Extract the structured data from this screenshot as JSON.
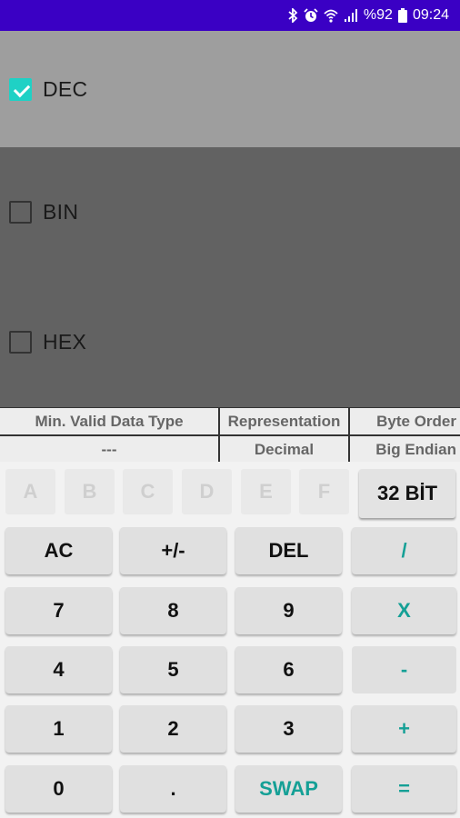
{
  "status_bar": {
    "battery_text": "%92",
    "time": "09:24",
    "icons": [
      "bluetooth-icon",
      "alarm-icon",
      "wifi-icon",
      "signal-icon",
      "battery-icon"
    ]
  },
  "modes": [
    {
      "label": "DEC",
      "checked": true
    },
    {
      "label": "BIN",
      "checked": false
    },
    {
      "label": "HEX",
      "checked": false
    }
  ],
  "info_table": {
    "headers": [
      "Min. Valid Data Type",
      "Representation",
      "Byte Order"
    ],
    "values": [
      "---",
      "Decimal",
      "Big Endian"
    ]
  },
  "keypad": {
    "hex_keys": [
      "A",
      "B",
      "C",
      "D",
      "E",
      "F"
    ],
    "bit_mode": "32 BİT",
    "rows": [
      [
        "AC",
        "+/-",
        "DEL",
        "/"
      ],
      [
        "7",
        "8",
        "9",
        "X"
      ],
      [
        "4",
        "5",
        "6",
        "-"
      ],
      [
        "1",
        "2",
        "3",
        "+"
      ],
      [
        "0",
        ".",
        "SWAP",
        "="
      ]
    ]
  },
  "colors": {
    "status_bar": "#3a00c4",
    "accent": "#15a096",
    "checkbox_checked": "#1fd1c5",
    "selected_mode_bg": "#9e9e9e",
    "unselected_mode_bg": "#626262"
  }
}
